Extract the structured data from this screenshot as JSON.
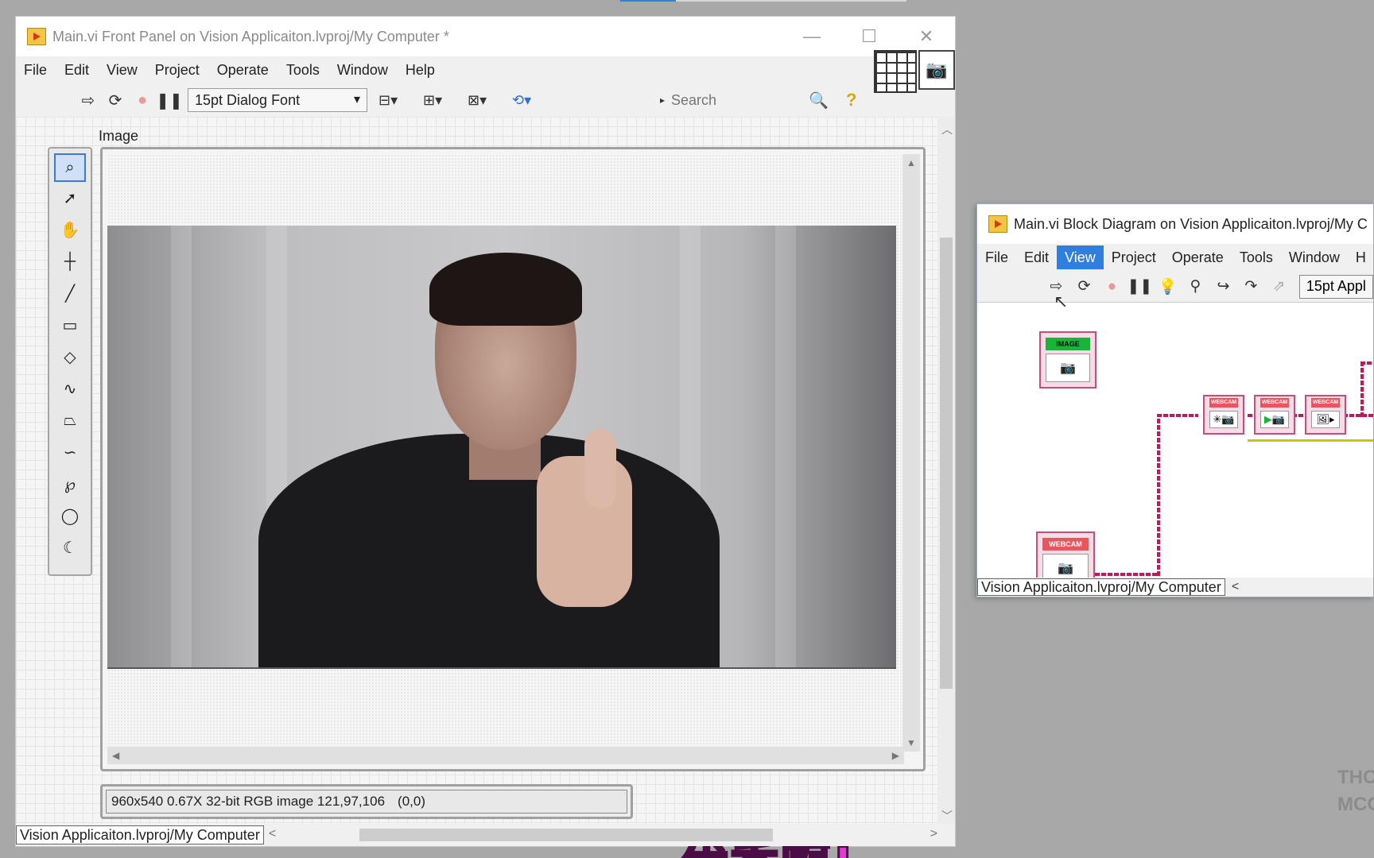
{
  "front_panel": {
    "title": "Main.vi Front Panel on Vision Applicaiton.lvproj/My Computer *",
    "window_buttons": {
      "minimize": "—",
      "maximize": "☐",
      "close": "✕"
    },
    "menu": [
      "File",
      "Edit",
      "View",
      "Project",
      "Operate",
      "Tools",
      "Window",
      "Help"
    ],
    "toolbar": {
      "font_select": "15pt Dialog Font",
      "search_placeholder": "Search"
    },
    "image_label": "Image",
    "tools": [
      "zoom-icon",
      "pointer-icon",
      "pan-icon",
      "point-icon",
      "line-icon",
      "rectangle-icon",
      "rotated-rect-icon",
      "polyline-icon",
      "polygon-icon",
      "freeline-icon",
      "freehand-icon",
      "oval-icon",
      "annulus-icon"
    ],
    "image_info": "960x540 0.67X 32-bit RGB image 121,97,106",
    "image_coords": "(0,0)",
    "caption": "优秀啊!",
    "project_path": "Vision Applicaiton.lvproj/My Computer",
    "scroll_left": "<",
    "scroll_right": ">"
  },
  "block_diagram": {
    "title": "Main.vi Block Diagram on Vision Applicaiton.lvproj/My C",
    "menu": [
      "File",
      "Edit",
      "View",
      "Project",
      "Operate",
      "Tools",
      "Window",
      "H"
    ],
    "active_menu": "View",
    "font_select": "15pt Appl",
    "nodes": {
      "image_constant": "IMAGE",
      "webcam_constant": "WEBCAM",
      "webcam_open": "WEBCAM",
      "webcam_start": "WEBCAM",
      "webcam_grab": "WEBCAM"
    },
    "project_path": "Vision Applicaiton.lvproj/My Computer",
    "scroll_left": "<"
  },
  "background_text": [
    "THO",
    "MCO"
  ],
  "colors": {
    "active_menu": "#2f7fe0",
    "caption": "#e23ad0",
    "wire_pink": "#c2185b",
    "wire_yellow": "#c8c800"
  }
}
